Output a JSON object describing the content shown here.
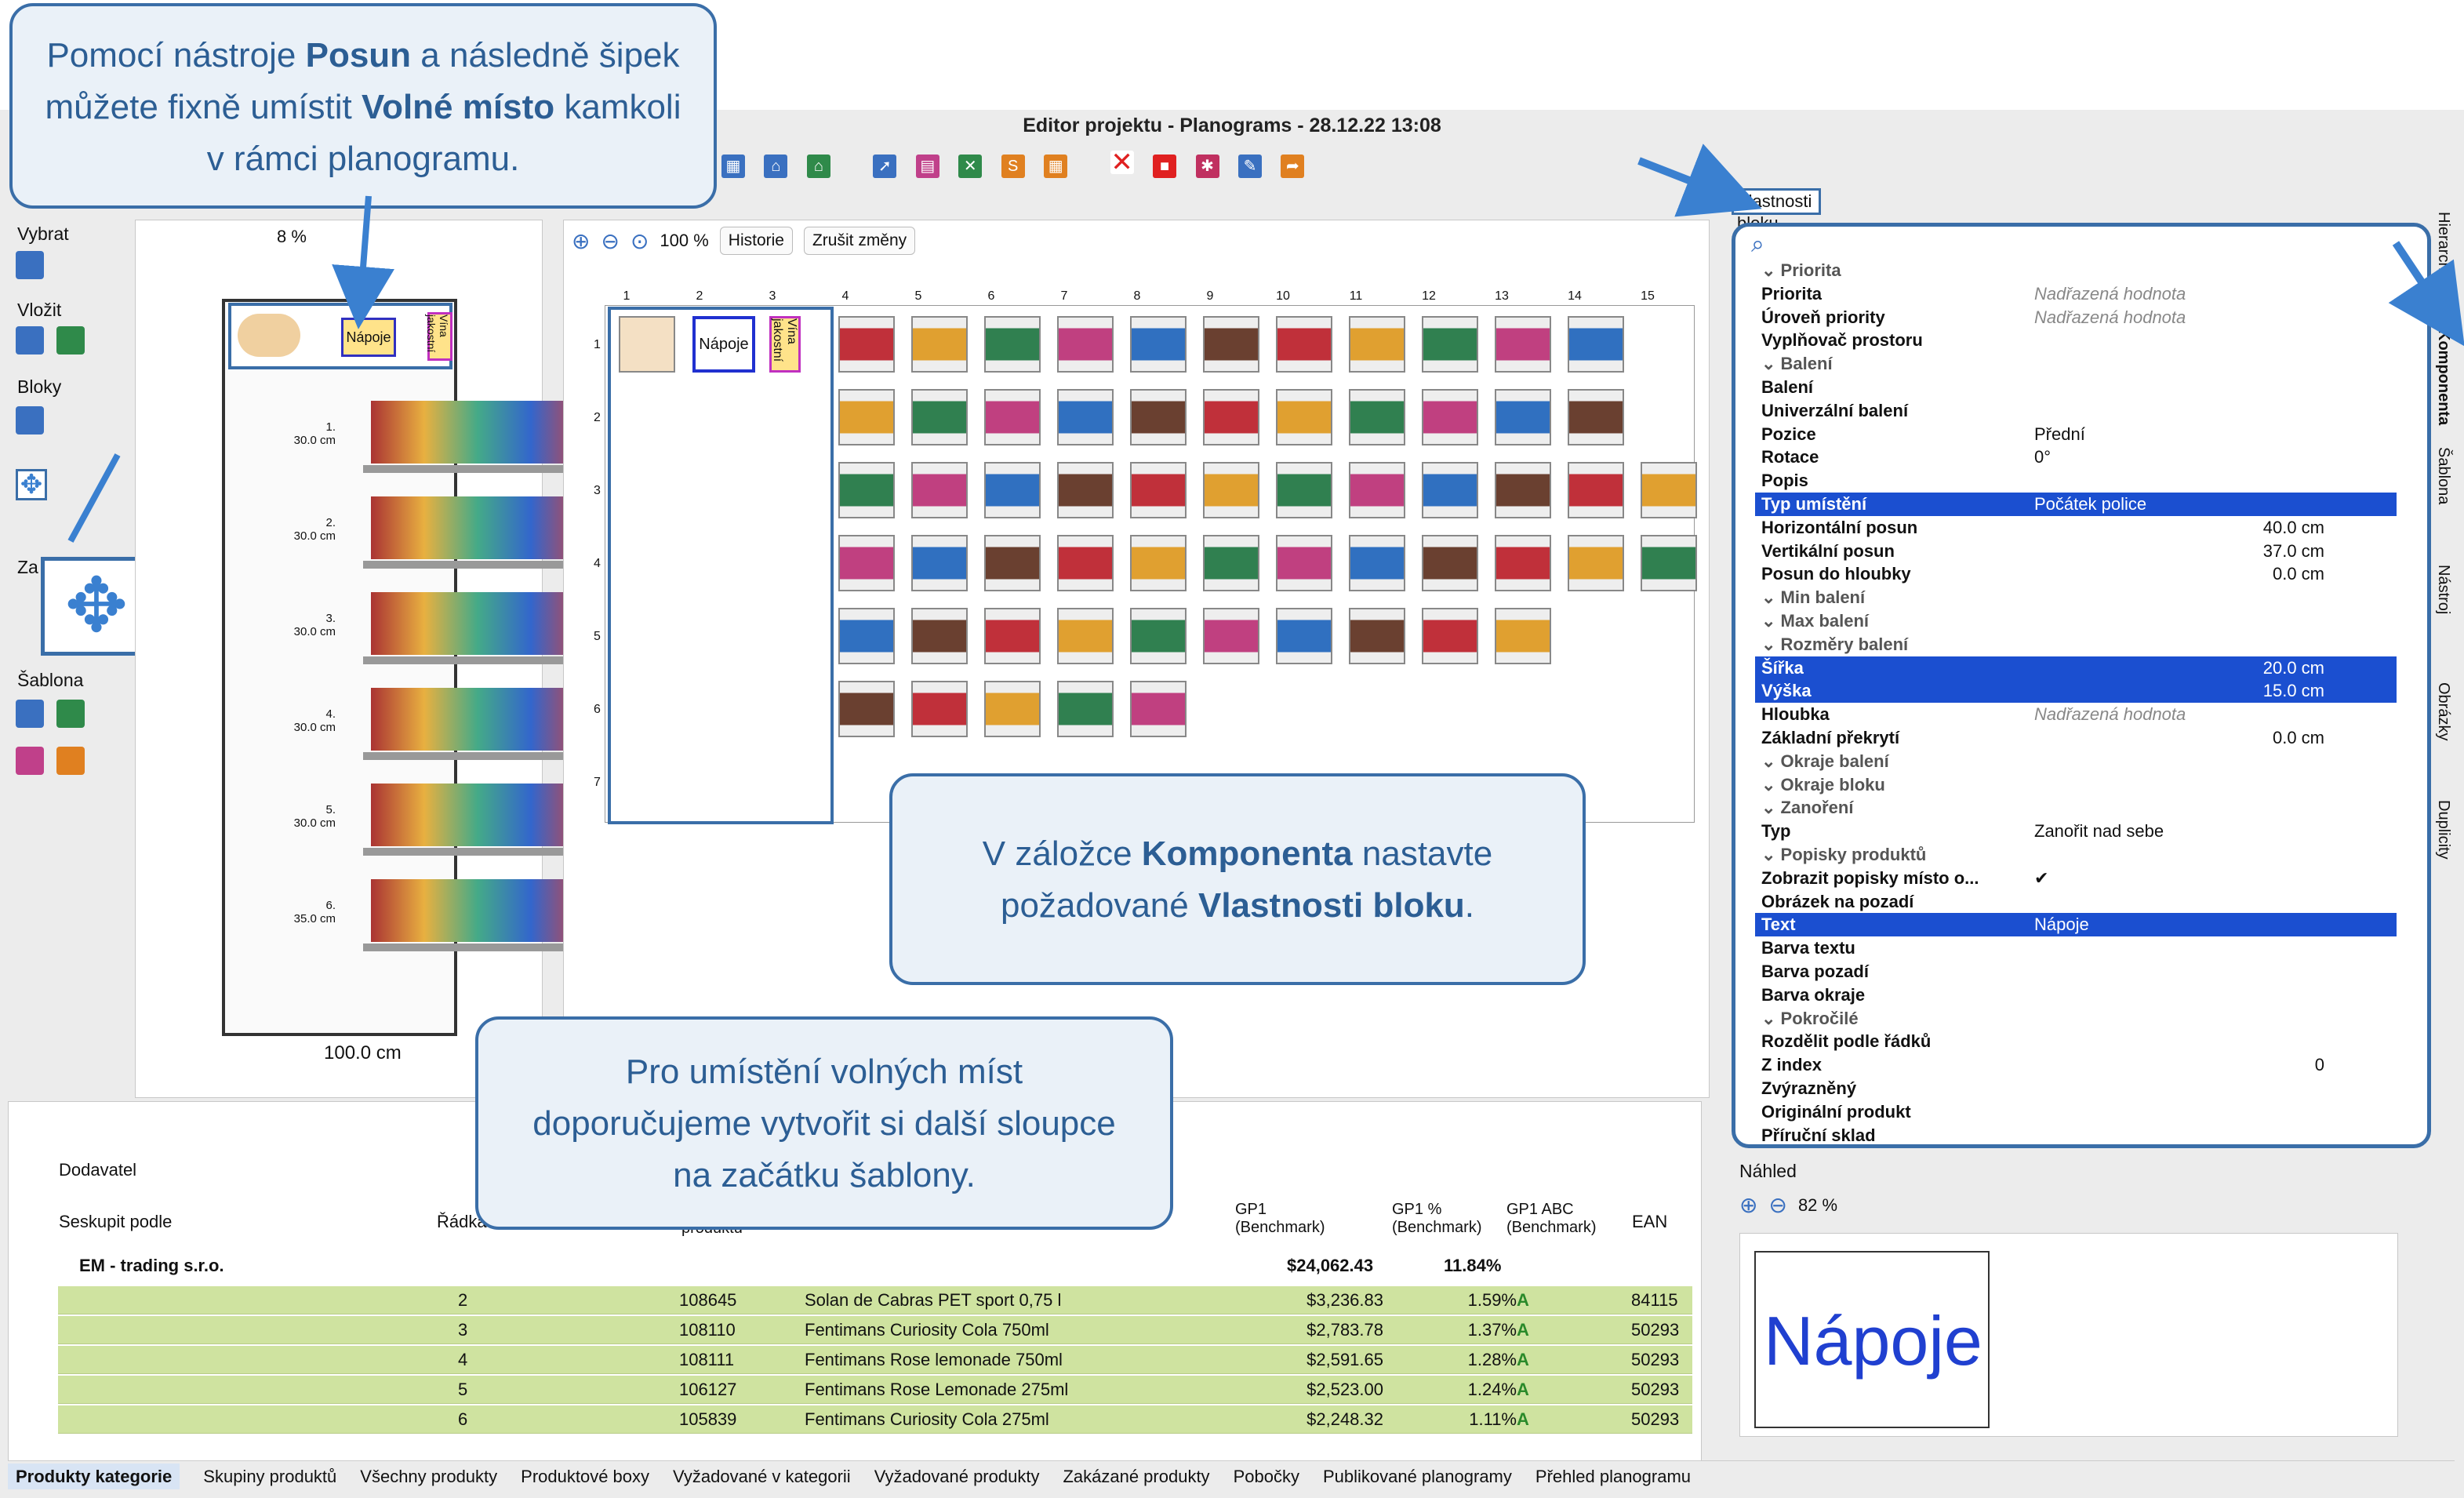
{
  "window": {
    "title": "Editor projektu - Planograms - 28.12.22 13:08"
  },
  "left_toolbar": {
    "vybrat": "Vybrat",
    "vlozit": "Vložit",
    "bloky": "Bloky",
    "za": "Za",
    "sablona": "Šablona"
  },
  "left_panel": {
    "zoom": "8 %",
    "width_label": "100.0 cm",
    "shelves": [
      {
        "n": "1.",
        "h": "30.0 cm"
      },
      {
        "n": "2.",
        "h": "30.0 cm"
      },
      {
        "n": "3.",
        "h": "30.0 cm"
      },
      {
        "n": "4.",
        "h": "30.0 cm"
      },
      {
        "n": "5.",
        "h": "30.0 cm"
      },
      {
        "n": "6.",
        "h": "35.0 cm"
      }
    ],
    "block_labels": [
      "Nápoje",
      "Vína jakostní"
    ]
  },
  "main_canvas": {
    "zoom": "100 %",
    "history_btn": "Historie",
    "cancel_btn": "Zrušit změny",
    "columns": [
      "1",
      "2",
      "3",
      "4",
      "5",
      "6",
      "7",
      "8",
      "9",
      "10",
      "11",
      "12",
      "13",
      "14",
      "15"
    ],
    "rows": [
      "1",
      "2",
      "3",
      "4",
      "5",
      "6",
      "7"
    ],
    "block_labels": [
      "Nápoje",
      "Vína jakostní"
    ]
  },
  "properties": {
    "title": "Vlastnosti bloku",
    "rows": [
      {
        "k": "Priorita",
        "sec": true
      },
      {
        "k": "Priorita",
        "v": "Nadřazená hodnota",
        "i": true
      },
      {
        "k": "Úroveň priority",
        "v": "Nadřazená hodnota",
        "i": true
      },
      {
        "k": "Vyplňovač prostoru",
        "v": ""
      },
      {
        "k": "Balení",
        "sec": true
      },
      {
        "k": "Balení",
        "v": ""
      },
      {
        "k": "Univerzální balení",
        "v": ""
      },
      {
        "k": "Pozice",
        "v": "Přední"
      },
      {
        "k": "Rotace",
        "v": "0°"
      },
      {
        "k": "Popis",
        "v": ""
      },
      {
        "k": "Typ umístění",
        "v": "Počátek police",
        "sel": true
      },
      {
        "k": "Horizontální posun",
        "v": "40.0 cm",
        "r": true
      },
      {
        "k": "Vertikální posun",
        "v": "37.0 cm",
        "r": true
      },
      {
        "k": "Posun do hloubky",
        "v": "0.0 cm",
        "r": true
      },
      {
        "k": "Min balení",
        "sec": true
      },
      {
        "k": "Max balení",
        "sec": true
      },
      {
        "k": "Rozměry balení",
        "sec": true
      },
      {
        "k": "Šířka",
        "v": "20.0 cm",
        "r": true,
        "sel": true
      },
      {
        "k": "Výška",
        "v": "15.0 cm",
        "r": true,
        "sel": true
      },
      {
        "k": "Hloubka",
        "v": "Nadřazená hodnota",
        "i": true
      },
      {
        "k": "Základní překrytí",
        "v": "0.0 cm",
        "r": true
      },
      {
        "k": "Okraje balení",
        "sec": true
      },
      {
        "k": "Okraje bloku",
        "sec": true
      },
      {
        "k": "Zanoření",
        "sec": true
      },
      {
        "k": "Typ",
        "v": "Zanořit nad sebe"
      },
      {
        "k": "Popisky produktů",
        "sec": true
      },
      {
        "k": "Zobrazit popisky místo o...",
        "v": "✔"
      },
      {
        "k": "Obrázek na pozadí",
        "v": ""
      },
      {
        "k": "Text",
        "v": "Nápoje",
        "sel": true
      },
      {
        "k": "Barva textu",
        "v": ""
      },
      {
        "k": "Barva pozadí",
        "v": ""
      },
      {
        "k": "Barva okraje",
        "v": ""
      },
      {
        "k": "Pokročilé",
        "sec": true
      },
      {
        "k": "Rozdělit podle řádků",
        "v": ""
      },
      {
        "k": "Z index",
        "v": "0",
        "r": true
      },
      {
        "k": "Zvýrazněný",
        "v": ""
      },
      {
        "k": "Originální produkt",
        "v": ""
      },
      {
        "k": "Příruční sklad",
        "v": ""
      }
    ]
  },
  "side_tabs": [
    "Hierarchie",
    "Komponenta",
    "Šablona",
    "Nástroj",
    "Obrázky",
    "Duplicity"
  ],
  "preview": {
    "title": "Náhled",
    "zoom": "82 %",
    "text": "Nápoje"
  },
  "table": {
    "sort_col": "Dodavatel",
    "group_by": "Seskupit podle",
    "headers": [
      "Řádka",
      "produktu",
      "GP1 (Benchmark)",
      "GP1 % (Benchmark)",
      "GP1 ABC (Benchmark)",
      "EAN"
    ],
    "group": {
      "name": "EM - trading s.r.o.",
      "gp1": "$24,062.43",
      "gp1p": "11.84%"
    },
    "rows": [
      {
        "r": "2",
        "id": "108645",
        "name": "Solan de Cabras PET sport 0,75 l",
        "gp": "$3,236.83",
        "pct": "1.59%",
        "abc": "A",
        "ean": "84115"
      },
      {
        "r": "3",
        "id": "108110",
        "name": "Fentimans Curiosity Cola 750ml",
        "gp": "$2,783.78",
        "pct": "1.37%",
        "abc": "A",
        "ean": "50293"
      },
      {
        "r": "4",
        "id": "108111",
        "name": "Fentimans Rose lemonade 750ml",
        "gp": "$2,591.65",
        "pct": "1.28%",
        "abc": "A",
        "ean": "50293"
      },
      {
        "r": "5",
        "id": "106127",
        "name": "Fentimans Rose Lemonade 275ml",
        "gp": "$2,523.00",
        "pct": "1.24%",
        "abc": "A",
        "ean": "50293"
      },
      {
        "r": "6",
        "id": "105839",
        "name": "Fentimans Curiosity Cola 275ml",
        "gp": "$2,248.32",
        "pct": "1.11%",
        "abc": "A",
        "ean": "50293"
      }
    ]
  },
  "bottom_tabs": [
    "Produkty kategorie",
    "Skupiny produktů",
    "Všechny produkty",
    "Produktové boxy",
    "Vyžadované v kategorii",
    "Vyžadované produkty",
    "Zakázané produkty",
    "Pobočky",
    "Publikované planogramy",
    "Přehled planogramu"
  ],
  "callouts": {
    "c1": "Pomocí nástroje <b>Posun</b> a následně šipek můžete fixně umístit <b>Volné místo</b> kamkoli v rámci planogramu.",
    "c2": "V záložce <b>Komponenta</b> nastavte požadované <b>Vlastnosti bloku</b>.",
    "c3": "Pro umístění volných míst doporučujeme vytvořit si další sloupce na začátku šablony."
  },
  "colors": {
    "accent": "#1b4fd0",
    "callout_border": "#3a6ea8",
    "row_green": "#cfe3a0",
    "arrow": "#3a80d0"
  }
}
